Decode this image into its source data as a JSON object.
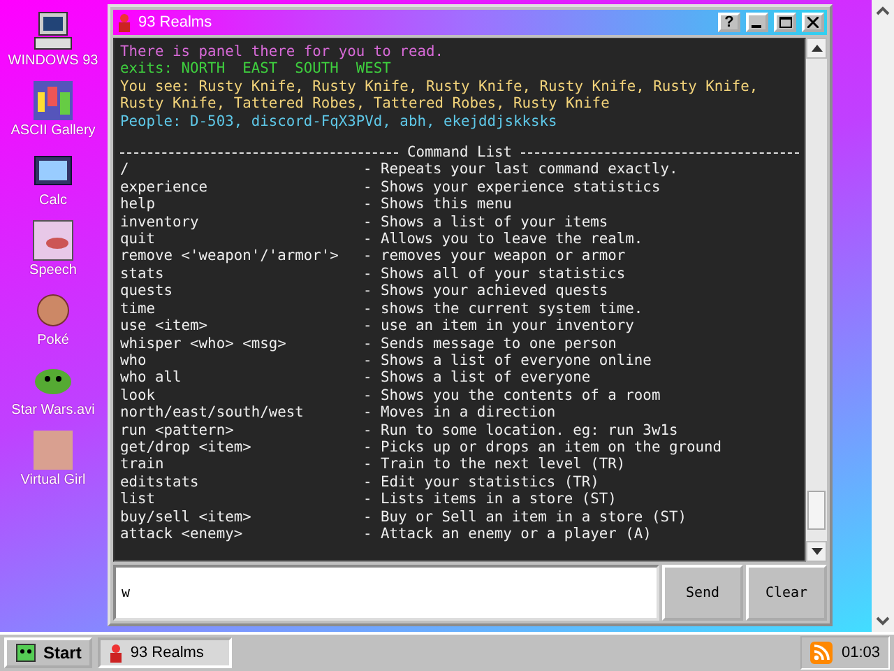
{
  "desktop_icons": [
    {
      "label": "WINDOWS 93",
      "kind": "computer"
    },
    {
      "label": "ASCII Gallery",
      "kind": "numbers"
    },
    {
      "label": "Calc",
      "kind": "calculator"
    },
    {
      "label": "Speech",
      "kind": "mouth"
    },
    {
      "label": "Poké",
      "kind": "ball"
    },
    {
      "label": "Star Wars.avi",
      "kind": "alien"
    },
    {
      "label": "Virtual Girl",
      "kind": "portrait"
    }
  ],
  "window": {
    "title": "93 Realms",
    "controls": [
      "?"
    ],
    "messages": [
      {
        "text": "There is panel there for you to read.",
        "color": "#d86ad8"
      },
      {
        "text": "exits: NORTH  EAST  SOUTH  WEST",
        "color": "#3ecf3e"
      },
      {
        "text": "You see: Rusty Knife, Rusty Knife, Rusty Knife, Rusty Knife, Rusty Knife, Rusty Knife, Tattered Robes, Tattered Robes, Rusty Knife",
        "color": "#f2d37a"
      },
      {
        "text": "People: D-503, discord-FqX3PVd, abh, ekejddjskksks",
        "color": "#5ec8e8"
      }
    ],
    "command_list_title": "Command List",
    "commands": [
      {
        "command": "/",
        "description": "- Repeats your last command exactly."
      },
      {
        "command": "experience",
        "description": "- Shows your experience statistics"
      },
      {
        "command": "help",
        "description": "- Shows this menu"
      },
      {
        "command": "inventory",
        "description": "- Shows a list of your items"
      },
      {
        "command": "quit",
        "description": "- Allows you to leave the realm."
      },
      {
        "command": "remove <'weapon'/'armor'>",
        "description": "- removes your weapon or armor"
      },
      {
        "command": "stats",
        "description": "- Shows all of your statistics"
      },
      {
        "command": "quests",
        "description": "- Shows your achieved quests"
      },
      {
        "command": "time",
        "description": "- shows the current system time."
      },
      {
        "command": "use <item>",
        "description": "- use an item in your inventory"
      },
      {
        "command": "whisper <who> <msg>",
        "description": "- Sends message to one person"
      },
      {
        "command": "who",
        "description": "- Shows a list of everyone online"
      },
      {
        "command": "who all",
        "description": "- Shows a list of everyone"
      },
      {
        "command": "look",
        "description": "- Shows you the contents of a room"
      },
      {
        "command": "north/east/south/west",
        "description": "- Moves in a direction"
      },
      {
        "command": "run <pattern>",
        "description": "- Run to some location. eg: run 3w1s"
      },
      {
        "command": "get/drop <item>",
        "description": "- Picks up or drops an item on the ground"
      },
      {
        "command": "train",
        "description": "- Train to the next level (TR)"
      },
      {
        "command": "editstats",
        "description": "- Edit your statistics (TR)"
      },
      {
        "command": "list",
        "description": "- Lists items in a store (ST)"
      },
      {
        "command": "buy/sell <item>",
        "description": "- Buy or Sell an item in a store (ST)"
      },
      {
        "command": "attack <enemy>",
        "description": "- Attack an enemy or a player (A)"
      }
    ],
    "input": {
      "value": "w"
    },
    "buttons": [
      "Send",
      "Clear"
    ]
  },
  "taskbar": {
    "start": "Start",
    "tasks": [
      {
        "label": "93 Realms",
        "selected": true
      }
    ],
    "clock": "01:03"
  }
}
